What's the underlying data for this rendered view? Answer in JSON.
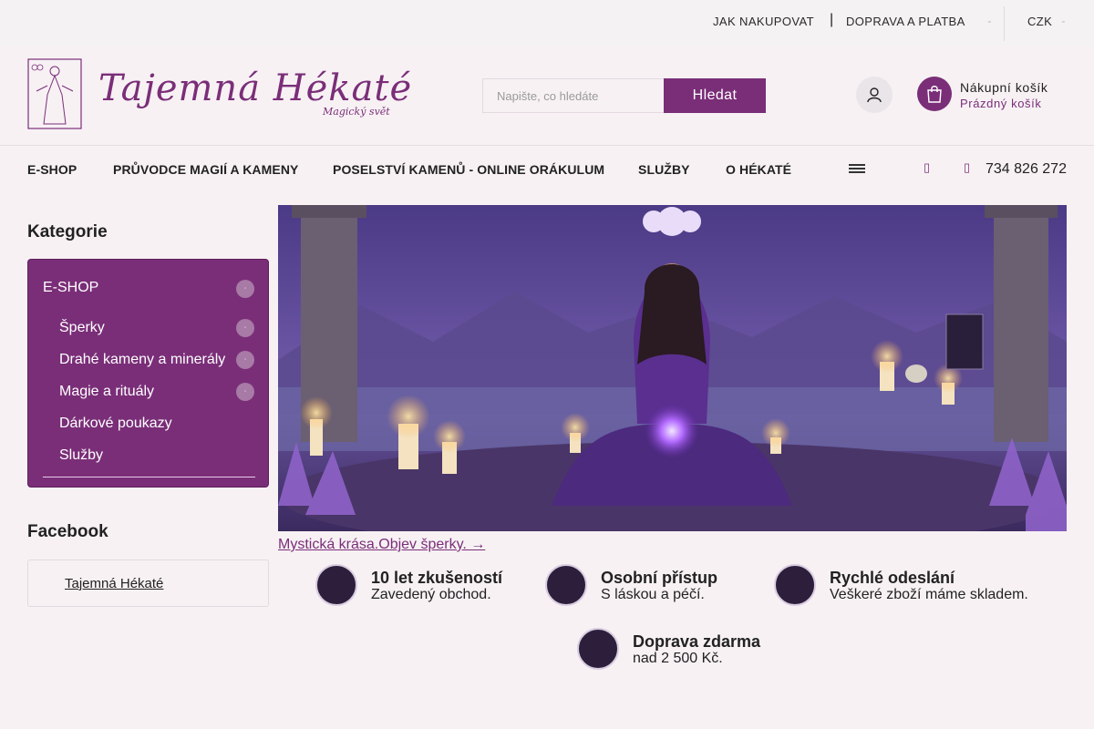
{
  "topbar": {
    "links": [
      "JAK NAKUPOVAT",
      "DOPRAVA A PLATBA"
    ],
    "currency": "CZK"
  },
  "brand": {
    "name": "Tajemná Hékaté",
    "tagline": "Magický svět"
  },
  "search": {
    "placeholder": "Napište, co hledáte",
    "button": "Hledat"
  },
  "cart": {
    "title": "Nákupní košík",
    "status": "Prázdný košík"
  },
  "nav": {
    "items": [
      "E-SHOP",
      "PRŮVODCE MAGIÍ A KAMENY",
      "POSELSTVÍ KAMENŮ - ONLINE ORÁKULUM",
      "SLUŽBY",
      "O HÉKATÉ"
    ],
    "phone": "734 826 272"
  },
  "sidebar": {
    "title": "Kategorie",
    "root": "E-SHOP",
    "items": [
      "Šperky",
      "Drahé kameny a minerály",
      "Magie a rituály",
      "Dárkové poukazy",
      "Služby"
    ]
  },
  "facebook": {
    "title": "Facebook",
    "link": "Tajemná Hékaté"
  },
  "banner": {
    "caption": "Mystická krása.Objev šperky. →"
  },
  "features": [
    {
      "title": "10 let zkušeností",
      "subtitle": "Zavedený obchod."
    },
    {
      "title": "Osobní přístup",
      "subtitle": "S láskou a péčí."
    },
    {
      "title": "Rychlé odeslání",
      "subtitle": "Veškeré zboží máme skladem."
    },
    {
      "title": "Doprava zdarma",
      "subtitle": "nad 2 500 Kč."
    }
  ],
  "colors": {
    "brand": "#7a2e78",
    "page_background": "#f7f1f4",
    "topbar": "#f4f2f3"
  },
  "icons": [
    "user-icon",
    "shopping-bag-icon",
    "hamburger-menu-icon",
    "chevron-down-icon",
    "email-icon",
    "phone-icon"
  ]
}
